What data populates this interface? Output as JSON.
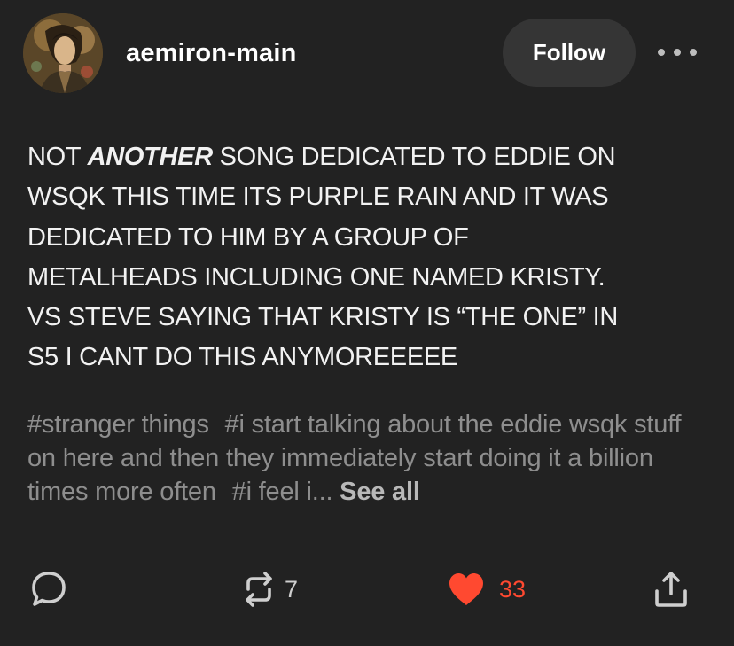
{
  "post": {
    "username": "aemiron-main",
    "follow_label": "Follow",
    "body_prefix": "NOT ",
    "body_emphasis": "ANOTHER",
    "body_lines": [
      " SONG DEDICATED TO EDDIE ON",
      "WSQK THIS TIME ITS PURPLE RAIN AND IT WAS",
      "DEDICATED TO HIM BY A GROUP OF",
      "METALHEADS INCLUDING ONE NAMED KRISTY.",
      "VS STEVE SAYING THAT KRISTY IS “THE ONE” IN",
      "S5 I CANT DO THIS ANYMOREEEEE"
    ],
    "tags": [
      "#stranger things",
      "#i start talking about the eddie wsqk stuff on here and then they immediately start doing it a billion times more often",
      "#i feel i..."
    ],
    "see_all_label": "See all"
  },
  "actions": {
    "reblog_count": "7",
    "like_count": "33"
  },
  "icons": {
    "reply": "speech-bubble-icon",
    "reblog": "reblog-arrows-icon",
    "like": "heart-icon",
    "share": "share-upload-icon",
    "more": "ellipsis-icon"
  },
  "colors": {
    "background": "#222222",
    "follow_button_bg": "#353535",
    "like_red": "#ff4930",
    "tag_gray": "#8e8e8e"
  }
}
